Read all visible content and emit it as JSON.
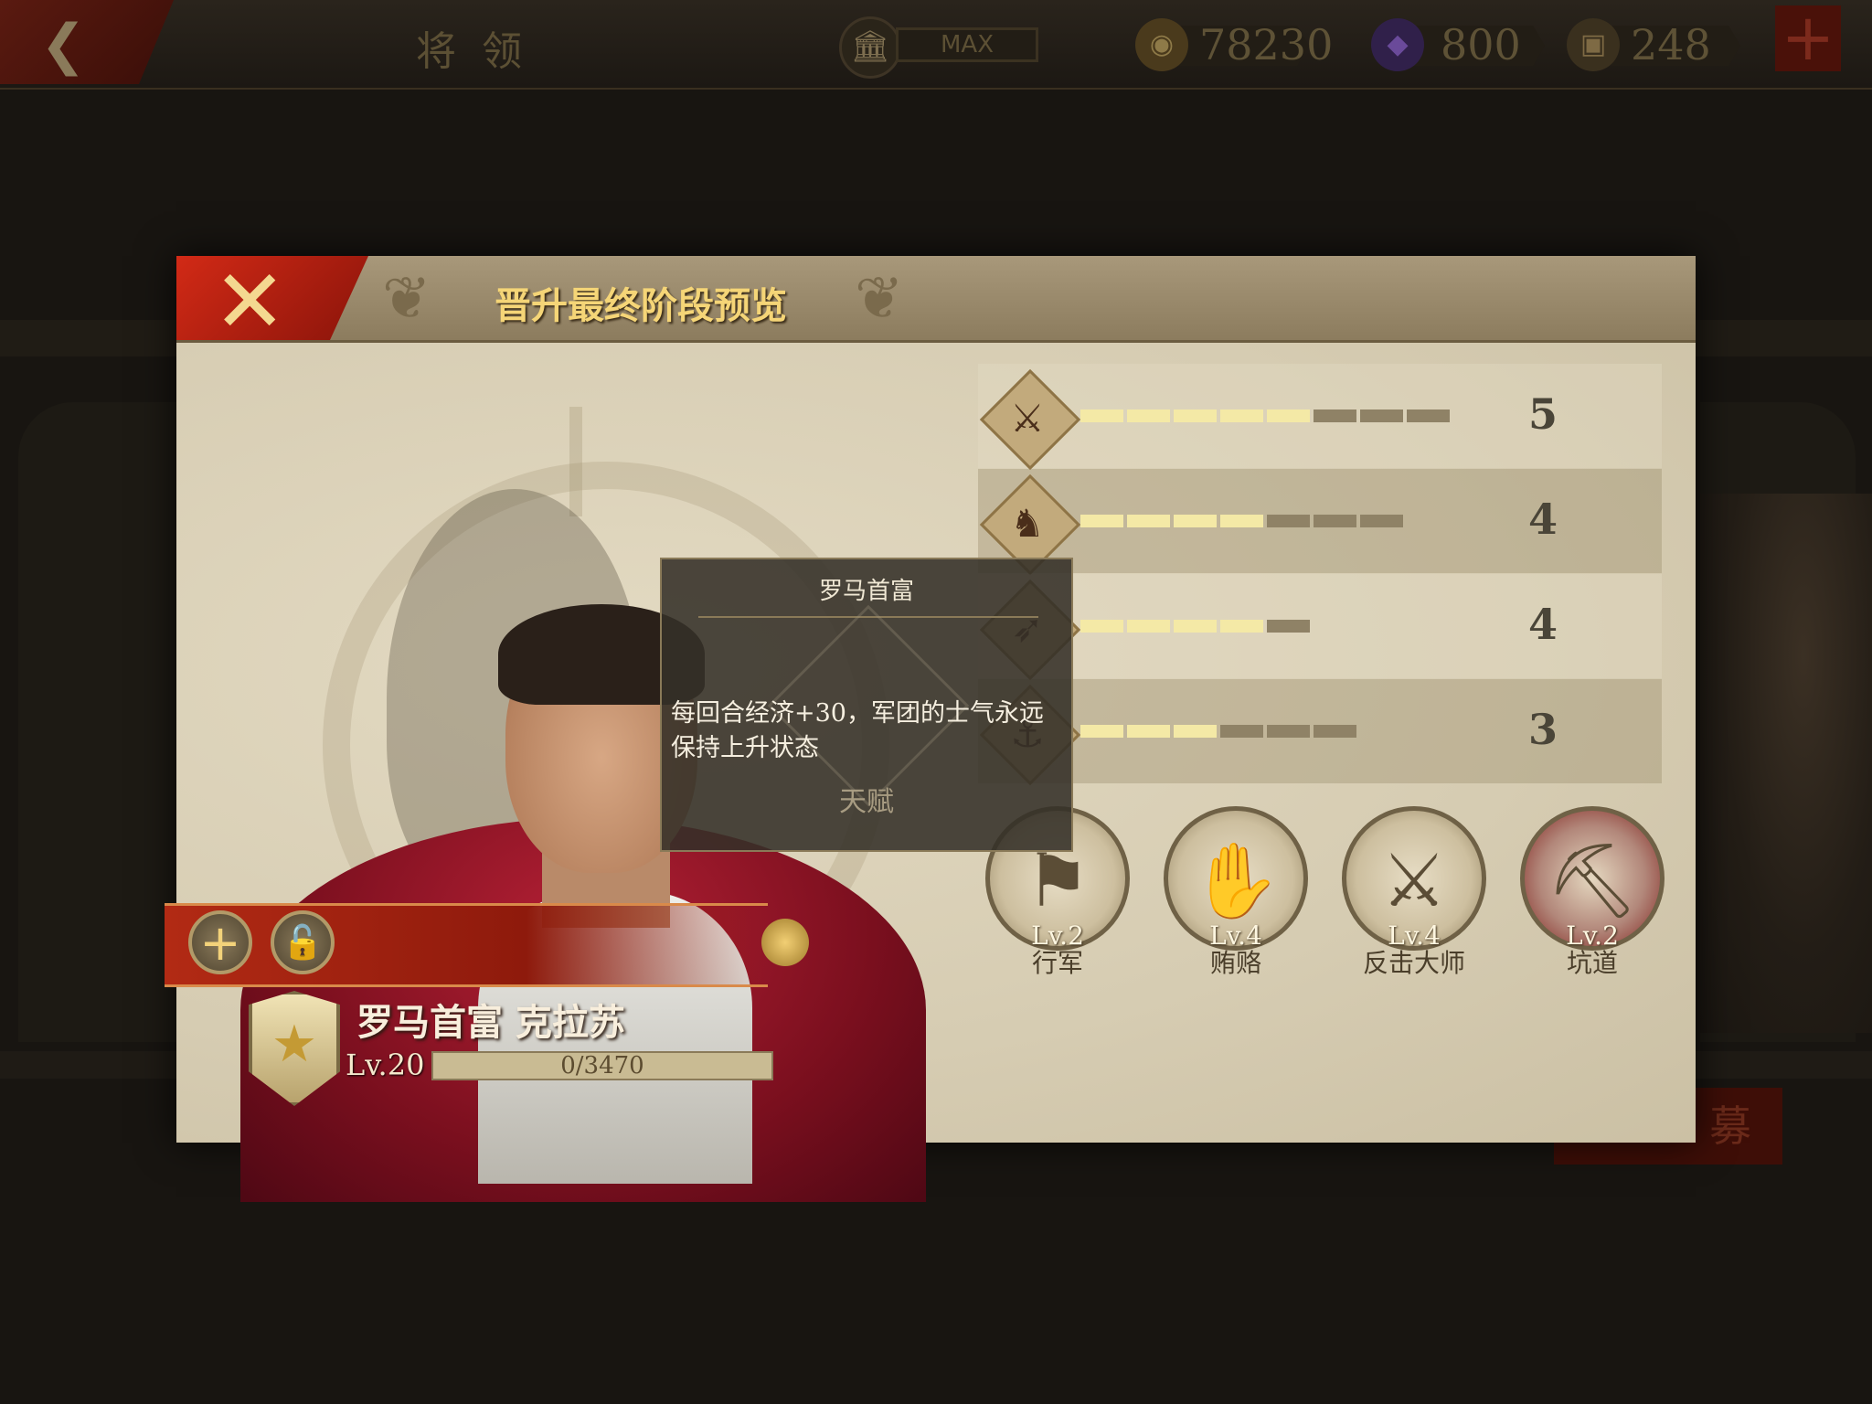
{
  "background": {
    "title": "将领",
    "building_level": "MAX",
    "resources": [
      {
        "name": "coin",
        "icon": "coin-icon",
        "value": "78230",
        "color": "#6e5a2c"
      },
      {
        "name": "gem",
        "icon": "gem-icon",
        "value": "800",
        "color": "#4a2a6a"
      },
      {
        "name": "treasure",
        "icon": "treasure-icon",
        "value": "248",
        "color": "#6a5a3c"
      }
    ],
    "recruit_label": "募"
  },
  "modal": {
    "title": "晋升最终阶段预览"
  },
  "hero": {
    "name": "罗马首富 克拉苏",
    "level": "Lv.20",
    "xp_text": "0/3470",
    "xp_fraction": 0
  },
  "stats": [
    {
      "icon": "sword-icon",
      "glyph": "⚔",
      "value": "5",
      "segments_on": 5,
      "segments_total": 8
    },
    {
      "icon": "horse-icon",
      "glyph": "♞",
      "value": "4",
      "segments_on": 4,
      "segments_total": 7
    },
    {
      "icon": "bow-icon",
      "glyph": "➶",
      "value": "4",
      "segments_on": 4,
      "segments_total": 5
    },
    {
      "icon": "anchor-icon",
      "glyph": "⚓",
      "value": "3",
      "segments_on": 3,
      "segments_total": 6
    }
  ],
  "skills": [
    {
      "level": "Lv.2",
      "name": "行军",
      "icon": "march-icon",
      "glyph": "⚑"
    },
    {
      "level": "Lv.4",
      "name": "贿赂",
      "icon": "bribe-icon",
      "glyph": "✋"
    },
    {
      "level": "Lv.4",
      "name": "反击大师",
      "icon": "counter-icon",
      "glyph": "⚔"
    },
    {
      "level": "Lv.2",
      "name": "坑道",
      "icon": "tunnel-icon",
      "glyph": "⛏"
    }
  ],
  "tooltip": {
    "title": "罗马首富",
    "description": "每回合经济+30，军团的士气永远保持上升状态",
    "tag": "天赋"
  },
  "colors": {
    "accent_red": "#b22a14",
    "title_gold": "#f5d577",
    "segment_on": "#f4e9a6",
    "segment_off": "#8f8266"
  }
}
